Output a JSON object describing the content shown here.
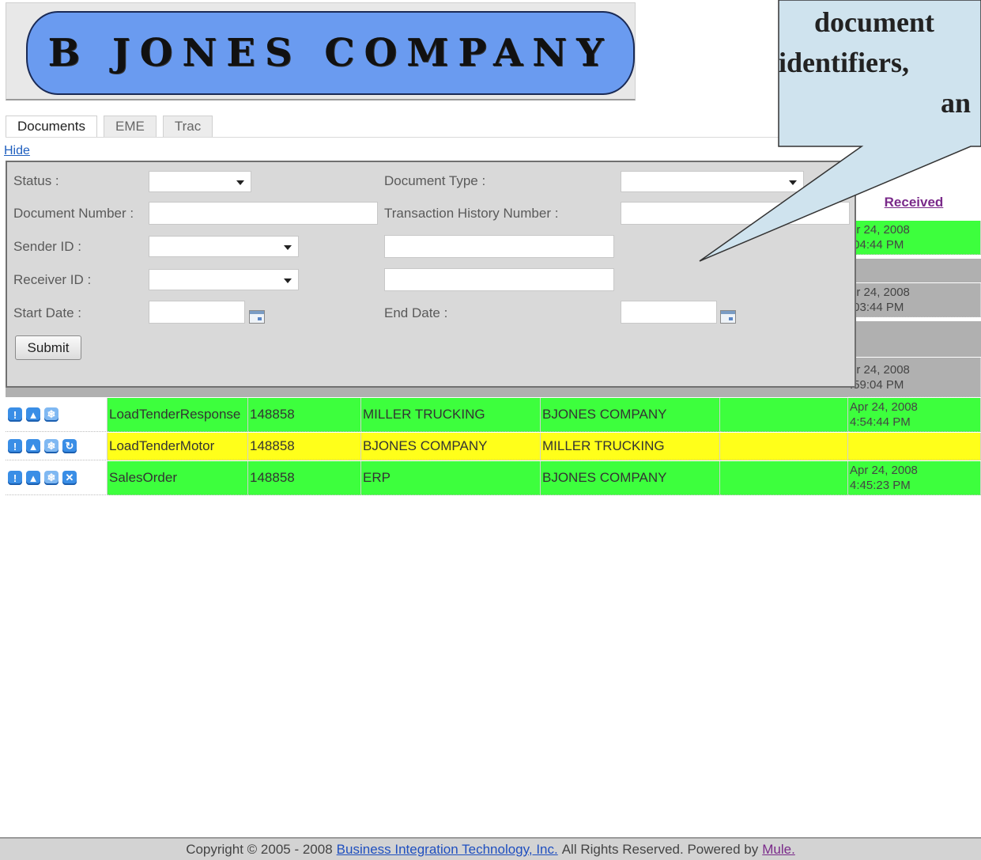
{
  "header": {
    "company_name": "B JONES COMPANY"
  },
  "tabs": [
    {
      "label": "Documents",
      "active": true
    },
    {
      "label": "EME",
      "active": false
    },
    {
      "label": "Trac",
      "active": false
    }
  ],
  "hide_link": "Hide",
  "search_form": {
    "status_label": "Status :",
    "document_type_label": "Document Type :",
    "document_number_label": "Document Number :",
    "transaction_history_number_label": "Transaction History Number :",
    "sender_id_label": "Sender ID :",
    "receiver_id_label": "Receiver ID :",
    "start_date_label": "Start Date :",
    "end_date_label": "End Date :",
    "submit_label": "Submit"
  },
  "table": {
    "received_header": "Received",
    "partial_times": [
      {
        "line1": "pr 24, 2008",
        "line2": ":04:44 PM"
      },
      {
        "line1": "pr 24, 2008",
        "line2": ":03:44 PM"
      },
      {
        "line1": "pr 24, 2008",
        "line2": ":59:04 PM"
      }
    ],
    "rows": [
      {
        "document_type": "LoadTenderResponse",
        "number": "148858",
        "sender": "MILLER TRUCKING",
        "receiver": "BJONES COMPANY",
        "col5": "",
        "received_date": "Apr 24, 2008",
        "received_time": "4:54:44 PM"
      },
      {
        "document_type": "LoadTenderMotor",
        "number": "148858",
        "sender": "BJONES COMPANY",
        "receiver": "MILLER TRUCKING",
        "col5": "",
        "received_date": "",
        "received_time": ""
      },
      {
        "document_type": "SalesOrder",
        "number": "148858",
        "sender": "ERP",
        "receiver": "BJONES COMPANY",
        "col5": "",
        "received_date": "Apr 24, 2008",
        "received_time": "4:45:23 PM"
      }
    ],
    "row_colors": {
      "green": "#3dff3d",
      "yellow": "#ffff1a",
      "grey": "#b0b0b0"
    }
  },
  "callout": {
    "line1": "document",
    "line2": "identifiers,",
    "line3": "an"
  },
  "footer": {
    "prefix": "Copyright © 2005 - 2008",
    "company_link": "Business Integration Technology, Inc.",
    "middle": "All Rights Reserved. Powered by",
    "mule_link": "Mule."
  }
}
